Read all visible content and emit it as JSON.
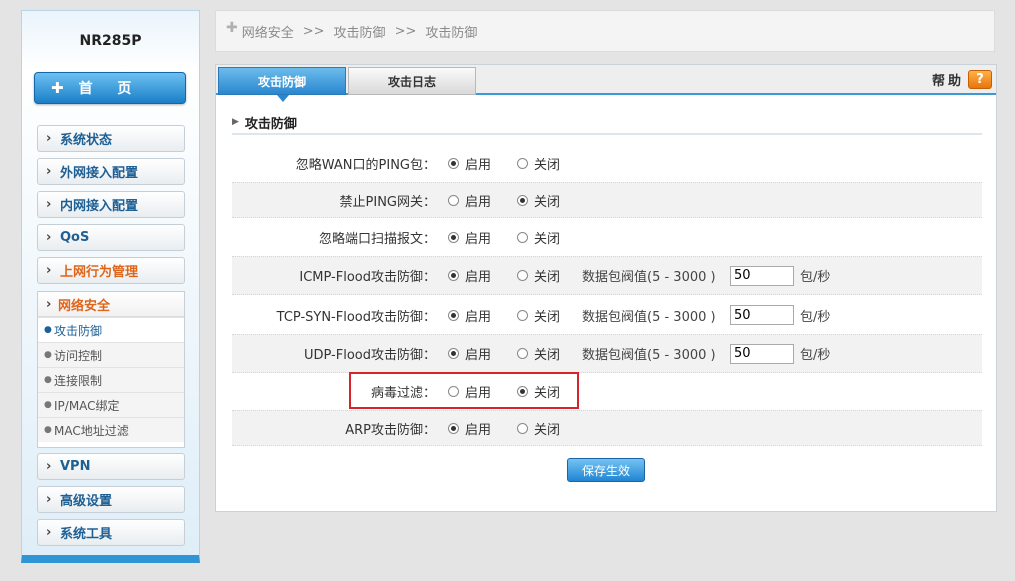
{
  "sidebar": {
    "model": "NR285P",
    "home_label": "首 页",
    "items": [
      {
        "label": "系统状态"
      },
      {
        "label": "外网接入配置"
      },
      {
        "label": "内网接入配置"
      },
      {
        "label": "QoS"
      },
      {
        "label": "上网行为管理"
      }
    ],
    "security_group": {
      "label": "网络安全",
      "subitems": [
        {
          "label": "攻击防御",
          "active": true
        },
        {
          "label": "访问控制"
        },
        {
          "label": "连接限制"
        },
        {
          "label": "IP/MAC绑定"
        },
        {
          "label": "MAC地址过滤"
        }
      ]
    },
    "items_after": [
      {
        "label": "VPN"
      },
      {
        "label": "高级设置"
      },
      {
        "label": "系统工具"
      }
    ]
  },
  "breadcrumb": {
    "part1": "网络安全",
    "sep1": ">>",
    "part2": "攻击防御",
    "sep2": ">>",
    "part3": "攻击防御"
  },
  "tabs": {
    "defense": "攻击防御",
    "log": "攻击日志",
    "active": "defense"
  },
  "help": {
    "label": "帮助",
    "icon": "?"
  },
  "section_title": "攻击防御",
  "options": {
    "enable": "启用",
    "disable": "关闭"
  },
  "threshold_label": "数据包阀值(5 - 3000 )",
  "unit": "包/秒",
  "rows": [
    {
      "label": "忽略WAN口的PING包：",
      "enabled": true
    },
    {
      "label": "禁止PING网关：",
      "enabled": false
    },
    {
      "label": "忽略端口扫描报文：",
      "enabled": true
    },
    {
      "label": "ICMP-Flood攻击防御：",
      "enabled": true,
      "threshold": "50"
    },
    {
      "label": "TCP-SYN-Flood攻击防御：",
      "enabled": true,
      "threshold": "50"
    },
    {
      "label": "UDP-Flood攻击防御：",
      "enabled": true,
      "threshold": "50"
    },
    {
      "label": "病毒过滤：",
      "enabled": false,
      "highlighted": true
    },
    {
      "label": "ARP攻击防御：",
      "enabled": true
    }
  ],
  "save_label": "保存生效",
  "colors": {
    "accent": "#2a87cf",
    "highlight": "#d6242a",
    "nav_orange": "#e0651a"
  }
}
